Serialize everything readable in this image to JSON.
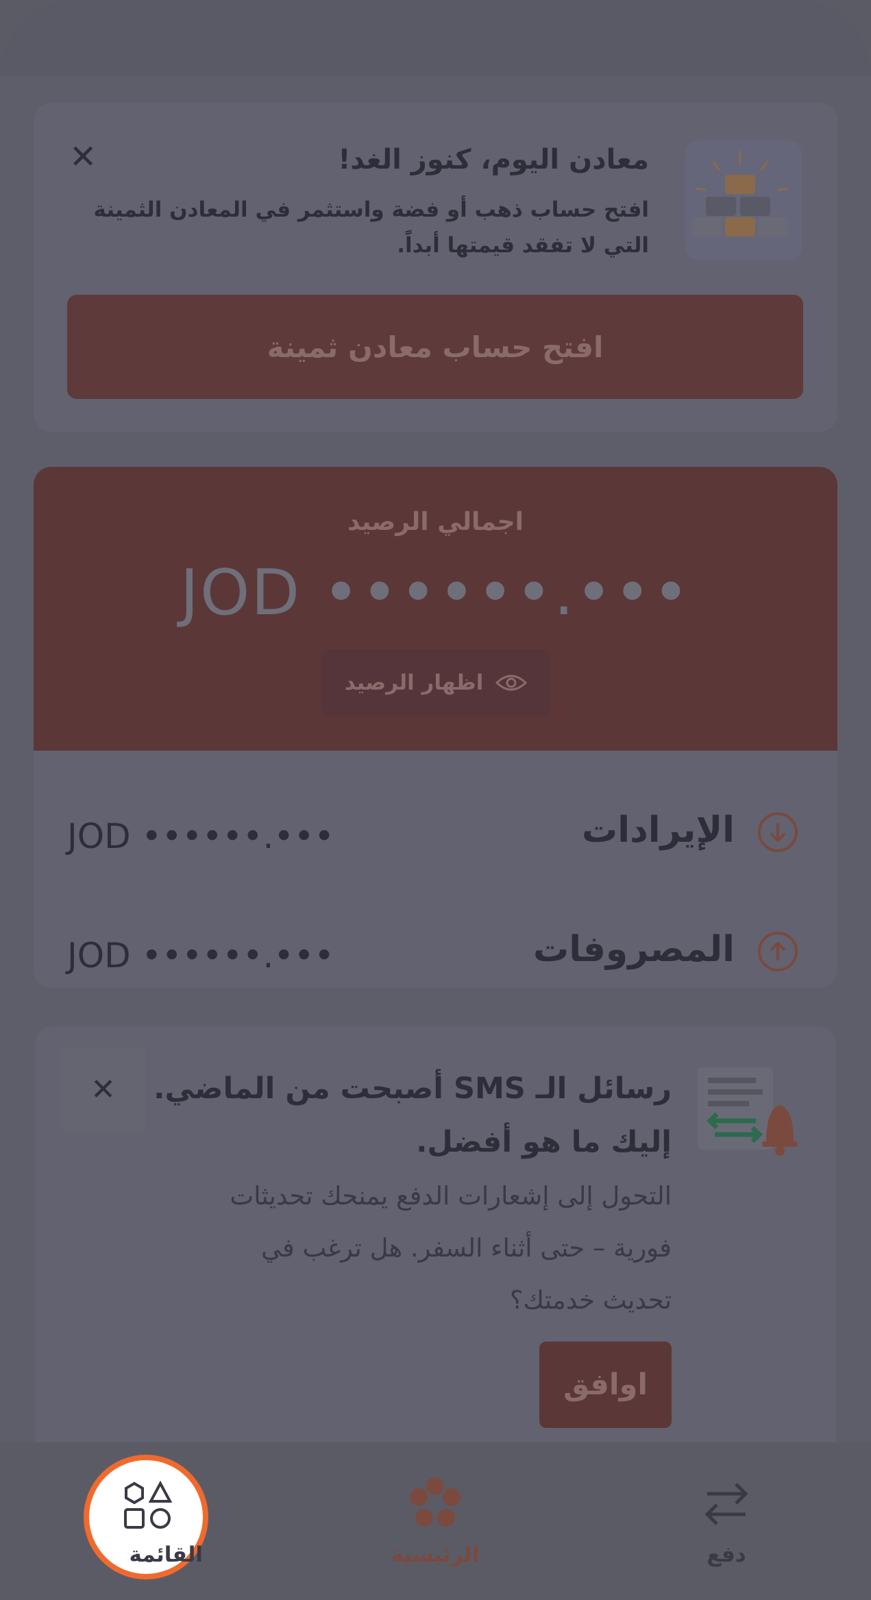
{
  "metals_card": {
    "title": "معادن اليوم، كنوز الغد!",
    "description_line1": "افتح حساب ذهب أو فضة واستثمر في المعادن الثمينة",
    "description_line2": "التي لا تفقد قيمتها أبداً.",
    "button_label": "افتح حساب معادن ثمينة",
    "close_icon": "close-icon"
  },
  "balance": {
    "label": "اجمالي الرصيد",
    "amount": "JOD ••••••.•••",
    "show_balance_label": "اظهار الرصيد",
    "income": {
      "label": "الإيرادات",
      "amount": "JOD ••••••.•••",
      "icon": "arrow-down-circle-icon"
    },
    "expenses": {
      "label": "المصروفات",
      "amount": "JOD ••••••.•••",
      "icon": "arrow-up-circle-icon"
    }
  },
  "sms_card": {
    "title_line1": "رسائل الـ SMS أصبحت من الماضي.",
    "title_line2": "إليك ما هو أفضل.",
    "description_line1": "التحول إلى إشعارات الدفع يمنحك تحديثات",
    "description_line2": "فورية – حتى أثناء السفر. هل ترغب في",
    "description_line3": "تحديث خدمتك؟",
    "agree_label": "اوافق"
  },
  "bottom_nav": {
    "pay_label": "دفع",
    "home_label": "الرئيسية",
    "menu_label": "القائمة"
  },
  "colors": {
    "overlay": "#5e5e6a",
    "accent": "#f06a2e",
    "brand_red": "#5c3738"
  }
}
